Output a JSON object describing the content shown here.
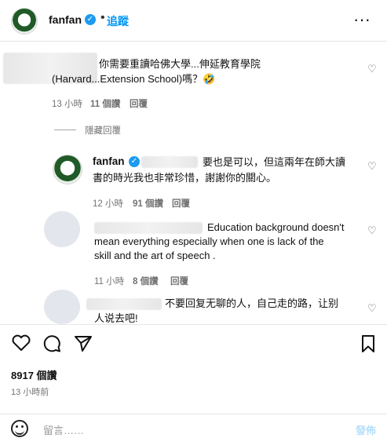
{
  "header": {
    "username": "fanfan",
    "verified_icon": "verified-check-icon",
    "separator": "•",
    "follow_label": "追蹤",
    "more_icon": "more-horizontal-icon"
  },
  "comments": [
    {
      "text_line1": "你需要重讀哈佛大學...伸延教育學院",
      "text_line2": "(Harvard...Extension School)嗎？🤣",
      "time": "13 小時",
      "likes": "11 個讚",
      "reply_label": "回覆"
    }
  ],
  "hide_replies_label": "隱藏回覆",
  "reply": {
    "username": "fanfan",
    "text_line1": "要也是可以，但這兩年在師大讀",
    "text_line2": "書的時光我也非常珍惜，謝謝你的關心。",
    "time": "12 小時",
    "likes": "91 個讚",
    "reply_label": "回覆"
  },
  "comment2": {
    "text_line1": "Education background doesn't",
    "text_line2": "mean everything especially when one is lack of the",
    "text_line3": "skill and the art of speech .",
    "time": "11 小時",
    "likes": "8 個讚",
    "reply_label": "回覆"
  },
  "comment3": {
    "text_line1": "不要回复无聊的人，自己走的路，让别",
    "text_line2": "人说去吧!"
  },
  "actions": {
    "like_icon": "heart-icon",
    "comment_icon": "comment-icon",
    "share_icon": "send-icon",
    "save_icon": "bookmark-icon"
  },
  "post": {
    "likes": "8917 個讚",
    "time": "13 小時前"
  },
  "composer": {
    "placeholder": "留言……",
    "post_label": "發佈",
    "emoji_icon": "emoji-icon"
  }
}
